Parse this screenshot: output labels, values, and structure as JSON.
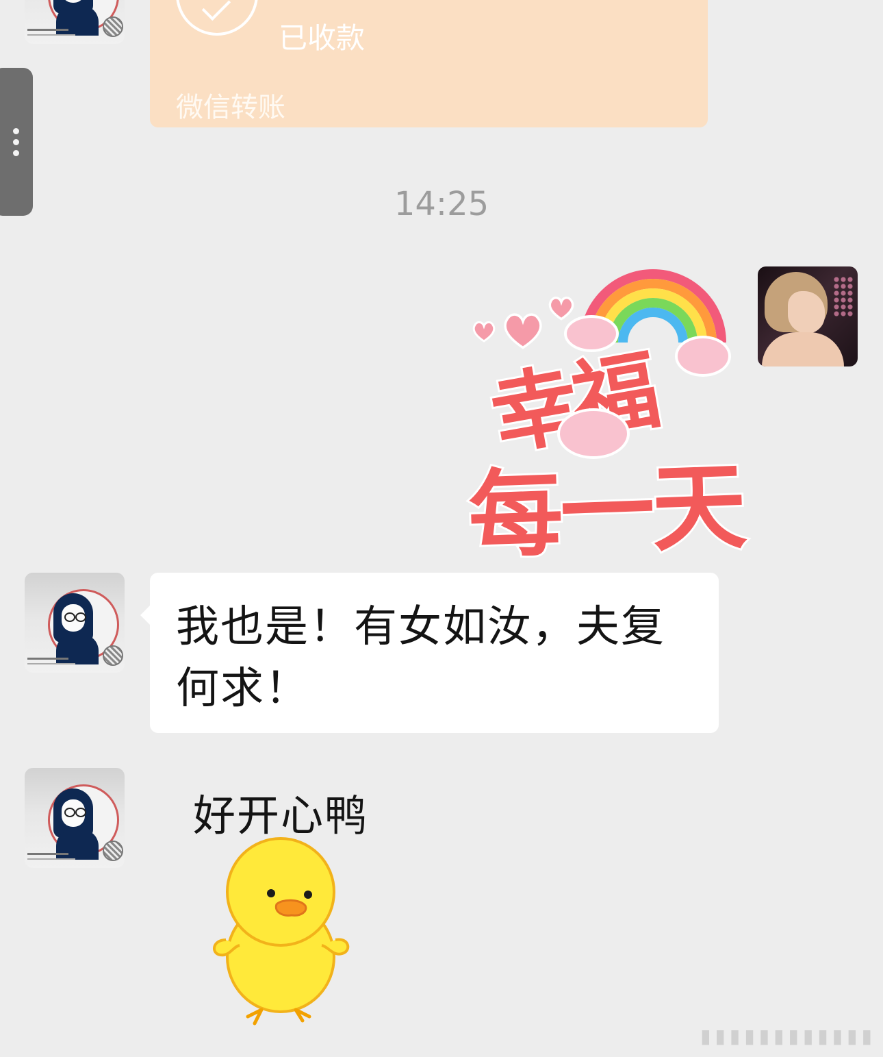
{
  "transfer": {
    "status": "已收款",
    "label": "微信转账"
  },
  "timestamp": "14:25",
  "sticker_happy": {
    "line1": "幸福",
    "line2": "每一天"
  },
  "messages": [
    {
      "text": "我也是！有女如汝，夫复何求！"
    }
  ],
  "sticker_duck": {
    "caption": "好开心鸭"
  },
  "colors": {
    "background": "#ededed",
    "transfer_card": "#fbdfc3",
    "bubble": "#ffffff",
    "sticker_text": "#f25a5a"
  }
}
